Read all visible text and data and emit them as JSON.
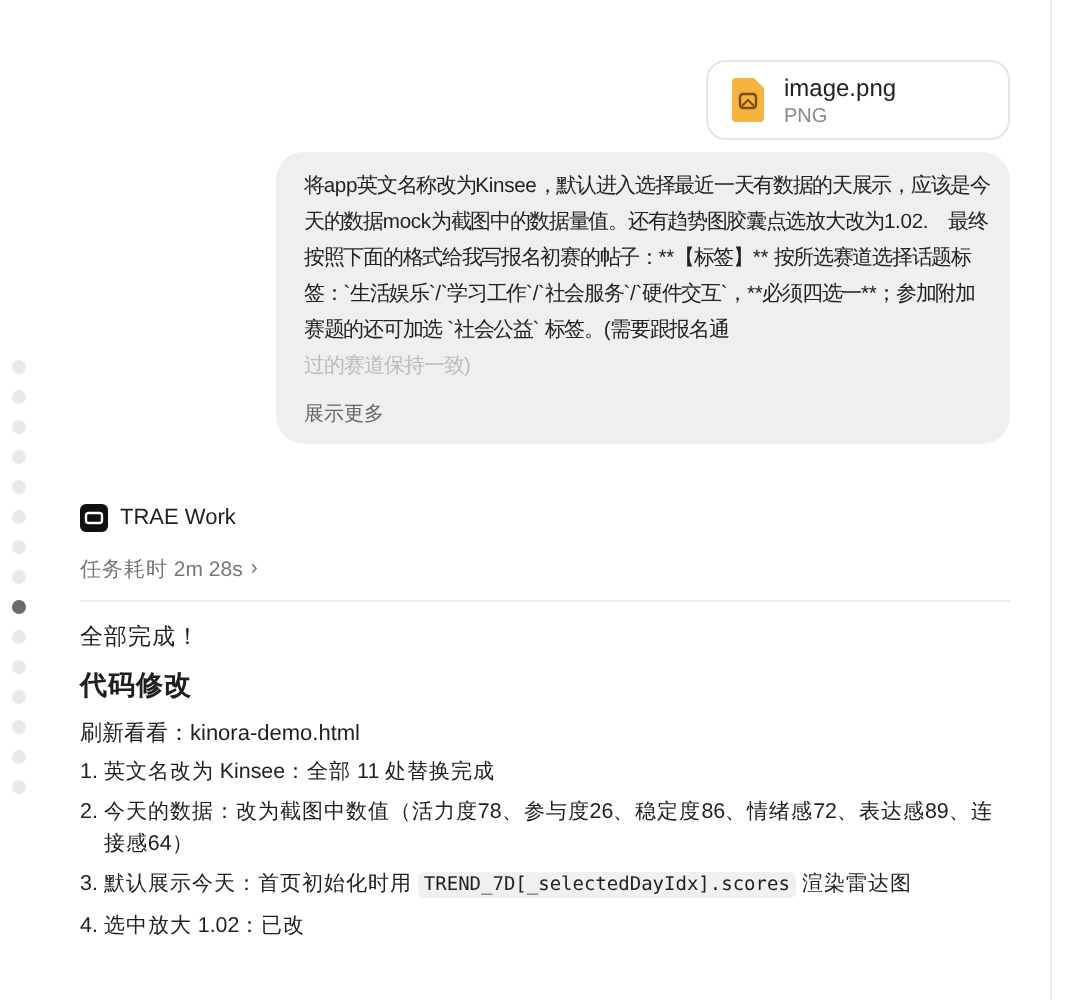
{
  "attachment": {
    "name": "image.png",
    "type": "PNG"
  },
  "message": {
    "text": "将app英文名称改为Kinsee，默认进入选择最近一天有数据的天展示，应该是今天的数据mock为截图中的数据量值。还有趋势图胶囊点选放大改为1.02.　最终按照下面的格式给我写报名初赛的帖子：**【标签】** 按所选赛道选择话题标签：`生活娱乐`/`学习工作`/`社会服务`/`硬件交互`，**必须四选一**；参加附加赛题的还可加选 `社会公益` 标签。(需要跟报名通",
    "faded_tail": "过的赛道保持一致)",
    "expand": "展示更多"
  },
  "timeline": [
    {
      "selected": false
    },
    {
      "selected": false
    },
    {
      "selected": false
    },
    {
      "selected": false
    },
    {
      "selected": false
    },
    {
      "selected": false
    },
    {
      "selected": false
    },
    {
      "selected": false
    },
    {
      "selected": true
    },
    {
      "selected": false
    },
    {
      "selected": false
    },
    {
      "selected": false
    },
    {
      "selected": false
    },
    {
      "selected": false
    },
    {
      "selected": false
    }
  ],
  "agent": {
    "name": "TRAE Work",
    "duration": "任务耗时 2m 28s",
    "chevron": "›"
  },
  "reply": {
    "status": "全部完成！",
    "heading": "代码修改",
    "refresh": "刷新看看：kinora-demo.html",
    "items": [
      {
        "number": "1.",
        "text": "英文名改为 Kinsee：全部 11 处替换完成"
      },
      {
        "number": "2.",
        "text": "今天的数据：改为截图中数值（活力度78、参与度26、稳定度86、情绪感72、表达感89、连接感64）"
      },
      {
        "number": "3.",
        "text": "默认展示今天：首页初始化时用 ",
        "code": "TREND_7D[_selectedDayIdx].scores",
        "after": " 渲染雷达图"
      },
      {
        "number": "4.",
        "text": "选中放大 1.02：已改"
      }
    ]
  }
}
